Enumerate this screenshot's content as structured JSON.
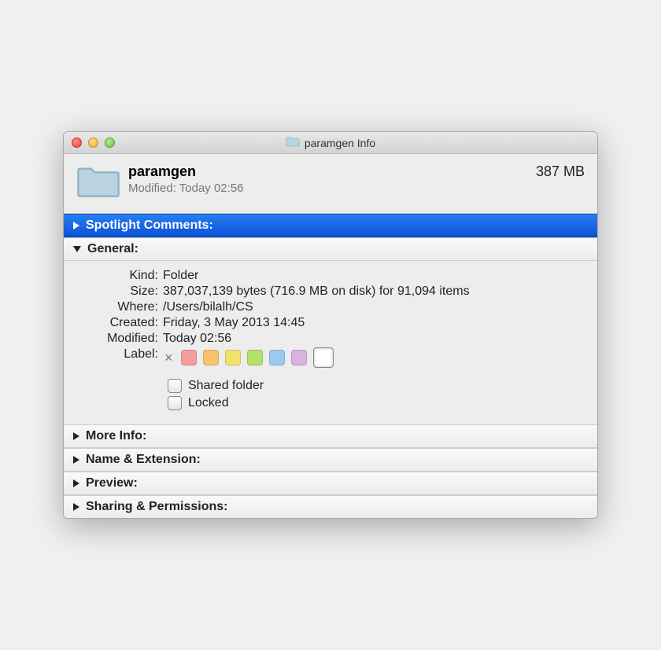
{
  "window": {
    "title": "paramgen Info"
  },
  "header": {
    "name": "paramgen",
    "modified": "Modified: Today 02:56",
    "size": "387 MB"
  },
  "sections": {
    "spotlight": {
      "label": "Spotlight Comments:"
    },
    "general": {
      "label": "General:",
      "kind_key": "Kind:",
      "kind_val": "Folder",
      "size_key": "Size:",
      "size_val": "387,037,139 bytes (716.9 MB on disk) for 91,094 items",
      "where_key": "Where:",
      "where_val": "/Users/bilalh/CS",
      "created_key": "Created:",
      "created_val": "Friday, 3 May 2013 14:45",
      "modified_key": "Modified:",
      "modified_val": "Today 02:56",
      "label_key": "Label:",
      "shared": "Shared folder",
      "locked": "Locked"
    },
    "moreinfo": {
      "label": "More Info:"
    },
    "nameext": {
      "label": "Name & Extension:"
    },
    "preview": {
      "label": "Preview:"
    },
    "sharing": {
      "label": "Sharing & Permissions:"
    }
  },
  "label_colors": [
    "#f59c9c",
    "#f5c46b",
    "#f1e26b",
    "#b2e26b",
    "#9cc9f0",
    "#d8b2e0"
  ]
}
